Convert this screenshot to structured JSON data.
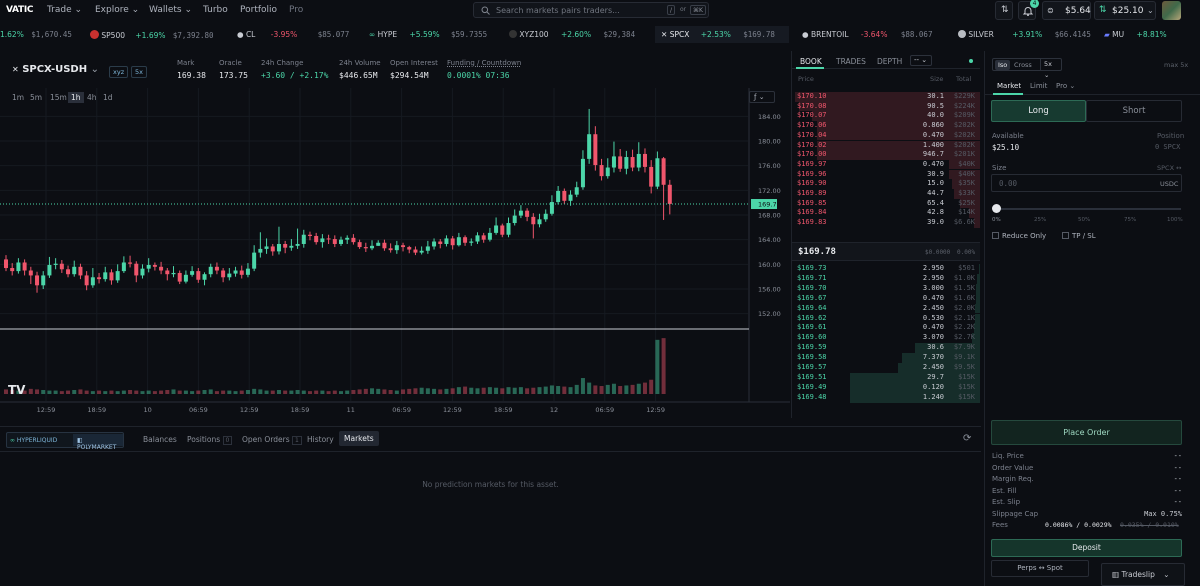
{
  "nav": {
    "logo": "VATIC",
    "items": [
      "Trade",
      "Explore",
      "Wallets",
      "Turbo",
      "Portfolio",
      "Pro"
    ],
    "search_placeholder": "Search markets pairs traders...",
    "kbd_slash": "/",
    "kbd_or": "or",
    "kbd_cmd": "⌘K",
    "notification_count": "4",
    "balance1": "$5.64",
    "balance2": "$25.10"
  },
  "ticker": [
    {
      "chg": "1.62%",
      "price": "$1,670.45",
      "dir": "up",
      "sym": ""
    },
    {
      "sym": "SP500",
      "chg": "+1.69%",
      "price": "$7,392.80",
      "dir": "up"
    },
    {
      "sym": "CL",
      "chg": "-3.95%",
      "price": "$85.077",
      "dir": "dn"
    },
    {
      "sym": "HYPE",
      "chg": "+5.59%",
      "price": "$59.7355",
      "dir": "up"
    },
    {
      "sym": "XYZ100",
      "chg": "+2.60%",
      "price": "$29,384",
      "dir": "up"
    },
    {
      "sym": "SPCX",
      "chg": "+2.53%",
      "price": "$169.78",
      "dir": "up"
    },
    {
      "sym": "BRENTOIL",
      "chg": "-3.64%",
      "price": "$88.067",
      "dir": "dn"
    },
    {
      "sym": "SILVER",
      "chg": "+3.91%",
      "price": "$66.4145",
      "dir": "up"
    },
    {
      "sym": "MU",
      "chg": "+8.81%",
      "price": "",
      "dir": "up"
    }
  ],
  "pair": {
    "symbol": "SPCX-USDH",
    "tag1": "xyz",
    "tag2": "5x",
    "stats": [
      {
        "label": "Mark",
        "value": "169.38",
        "dir": ""
      },
      {
        "label": "Oracle",
        "value": "173.75",
        "dir": ""
      },
      {
        "label": "24h Change",
        "value": "+3.60 / +2.17%",
        "dir": "up"
      },
      {
        "label": "24h Volume",
        "value": "$446.65M",
        "dir": ""
      },
      {
        "label": "Open Interest",
        "value": "$294.54M",
        "dir": ""
      },
      {
        "label": "Funding / Countdown",
        "value": "0.0001% 07:36",
        "dir": "up"
      }
    ]
  },
  "chart": {
    "intervals": [
      "1m",
      "5m",
      "15m",
      "1h",
      "4h",
      "1d"
    ],
    "active_interval": "1h",
    "fx_label": "ƒ",
    "price_ticks": [
      "184.00",
      "180.00",
      "176.00",
      "172.00",
      "168.00",
      "164.00",
      "160.00",
      "156.00",
      "152.00"
    ],
    "last_price_tag": "169.78",
    "time_ticks": [
      "12:59",
      "18:59",
      "10",
      "06:59",
      "12:59",
      "18:59",
      "11",
      "06:59",
      "12:59",
      "18:59",
      "12",
      "06:59",
      "12:59"
    ],
    "watermark": "TV",
    "colors": {
      "up": "#4cd6a9",
      "down": "#f0566c"
    }
  },
  "chart_data": {
    "type": "candlestick",
    "title": "",
    "xlabel": "",
    "ylabel": "",
    "ylim": [
      150,
      186
    ],
    "x_tick_labels": [
      "12:59",
      "18:59",
      "10",
      "06:59",
      "12:59",
      "18:59",
      "11",
      "06:59",
      "12:59",
      "18:59",
      "12",
      "06:59",
      "12:59"
    ],
    "y_tick_labels": [
      "184.00",
      "180.00",
      "176.00",
      "172.00",
      "168.00",
      "164.00",
      "160.00",
      "156.00",
      "152.00"
    ],
    "last_price": 169.78,
    "candles": [
      [
        160.8,
        159.4,
        161.5,
        158.9
      ],
      [
        159.4,
        158.9,
        160.2,
        158.2
      ],
      [
        158.9,
        160.3,
        161.0,
        158.5
      ],
      [
        160.3,
        159.0,
        160.8,
        158.2
      ],
      [
        159.0,
        158.2,
        159.6,
        156.8
      ],
      [
        158.2,
        156.6,
        158.8,
        155.4
      ],
      [
        156.6,
        158.2,
        158.9,
        156.0
      ],
      [
        158.2,
        159.9,
        161.2,
        157.8
      ],
      [
        159.9,
        160.1,
        161.0,
        159.2
      ],
      [
        160.1,
        159.2,
        160.7,
        158.6
      ],
      [
        159.2,
        158.4,
        159.8,
        157.9
      ],
      [
        158.4,
        159.6,
        160.6,
        158.0
      ],
      [
        159.6,
        158.2,
        160.1,
        157.6
      ],
      [
        158.2,
        156.6,
        158.9,
        155.8
      ],
      [
        156.6,
        157.9,
        159.4,
        156.2
      ],
      [
        157.9,
        157.6,
        158.6,
        156.9
      ],
      [
        157.6,
        158.7,
        159.6,
        157.2
      ],
      [
        158.7,
        157.4,
        159.2,
        156.7
      ],
      [
        157.4,
        158.9,
        160.0,
        157.0
      ],
      [
        158.9,
        160.3,
        161.3,
        158.6
      ],
      [
        160.3,
        160.1,
        161.4,
        159.5
      ],
      [
        160.1,
        158.2,
        160.5,
        157.1
      ],
      [
        158.2,
        159.3,
        160.0,
        157.7
      ],
      [
        159.3,
        159.9,
        161.0,
        158.7
      ],
      [
        159.9,
        159.6,
        160.3,
        159.0
      ],
      [
        159.6,
        159.0,
        160.4,
        158.4
      ],
      [
        159.0,
        158.4,
        159.4,
        157.4
      ],
      [
        158.4,
        158.6,
        159.7,
        157.9
      ],
      [
        158.6,
        157.2,
        159.0,
        156.8
      ],
      [
        157.2,
        158.3,
        159.0,
        156.9
      ],
      [
        158.3,
        158.9,
        159.7,
        158.0
      ],
      [
        158.9,
        157.5,
        159.4,
        157.0
      ],
      [
        157.5,
        158.4,
        158.7,
        156.6
      ],
      [
        158.4,
        159.6,
        160.1,
        157.9
      ],
      [
        159.6,
        159.0,
        160.3,
        158.4
      ],
      [
        159.0,
        157.9,
        159.4,
        157.1
      ],
      [
        157.9,
        158.5,
        159.4,
        157.4
      ],
      [
        158.5,
        159.0,
        159.6,
        158.0
      ],
      [
        159.0,
        158.3,
        159.8,
        157.7
      ],
      [
        158.3,
        159.3,
        160.2,
        157.9
      ],
      [
        159.3,
        161.9,
        163.1,
        158.9
      ],
      [
        161.9,
        162.5,
        165.2,
        161.1
      ],
      [
        162.5,
        162.9,
        164.2,
        161.7
      ],
      [
        162.9,
        162.1,
        163.3,
        161.4
      ],
      [
        162.1,
        163.3,
        166.1,
        161.6
      ],
      [
        163.3,
        162.7,
        163.8,
        161.8
      ],
      [
        162.7,
        163.0,
        164.1,
        162.2
      ],
      [
        163.0,
        163.3,
        165.8,
        162.5
      ],
      [
        163.3,
        164.8,
        165.6,
        162.7
      ],
      [
        164.8,
        164.6,
        165.3,
        163.9
      ],
      [
        164.6,
        163.6,
        165.1,
        163.2
      ],
      [
        163.6,
        164.2,
        164.9,
        162.7
      ],
      [
        164.2,
        164.1,
        164.8,
        163.3
      ],
      [
        164.1,
        163.3,
        164.7,
        162.8
      ],
      [
        163.3,
        164.0,
        164.5,
        163.0
      ],
      [
        164.0,
        164.3,
        164.7,
        163.3
      ],
      [
        164.3,
        163.6,
        164.9,
        163.2
      ],
      [
        163.6,
        162.8,
        164.0,
        162.5
      ],
      [
        162.8,
        162.6,
        163.5,
        162.0
      ],
      [
        162.6,
        163.0,
        163.9,
        162.3
      ],
      [
        163.0,
        163.5,
        163.9,
        163.0
      ],
      [
        163.5,
        162.6,
        164.0,
        162.2
      ],
      [
        162.6,
        162.3,
        163.4,
        161.9
      ],
      [
        162.3,
        163.1,
        163.8,
        161.7
      ],
      [
        163.1,
        162.8,
        163.5,
        162.1
      ],
      [
        162.8,
        162.4,
        163.0,
        161.8
      ],
      [
        162.4,
        161.9,
        162.9,
        161.5
      ],
      [
        161.9,
        162.2,
        162.9,
        161.6
      ],
      [
        162.2,
        162.9,
        163.8,
        161.7
      ],
      [
        162.9,
        163.7,
        164.2,
        162.4
      ],
      [
        163.7,
        163.3,
        164.1,
        162.6
      ],
      [
        163.3,
        164.2,
        164.7,
        162.9
      ],
      [
        164.2,
        163.1,
        164.6,
        162.4
      ],
      [
        163.1,
        164.4,
        165.1,
        162.9
      ],
      [
        164.4,
        163.5,
        164.7,
        163.0
      ],
      [
        163.5,
        163.7,
        164.2,
        163.0
      ],
      [
        163.7,
        164.7,
        165.2,
        163.3
      ],
      [
        164.7,
        164.0,
        165.1,
        163.5
      ],
      [
        164.0,
        165.1,
        165.9,
        163.7
      ],
      [
        165.1,
        166.3,
        167.6,
        164.8
      ],
      [
        166.3,
        164.8,
        166.6,
        164.4
      ],
      [
        164.8,
        166.7,
        167.6,
        164.4
      ],
      [
        166.7,
        167.9,
        168.9,
        166.3
      ],
      [
        167.9,
        168.7,
        169.6,
        167.5
      ],
      [
        168.7,
        167.7,
        169.1,
        167.0
      ],
      [
        167.7,
        166.5,
        168.3,
        164.2
      ],
      [
        166.5,
        167.3,
        168.2,
        166.0
      ],
      [
        167.3,
        168.2,
        168.9,
        166.9
      ],
      [
        168.2,
        170.1,
        171.2,
        167.9
      ],
      [
        170.1,
        171.9,
        172.7,
        169.7
      ],
      [
        171.9,
        170.3,
        172.3,
        169.8
      ],
      [
        170.3,
        171.3,
        172.0,
        169.5
      ],
      [
        171.3,
        172.5,
        173.4,
        170.9
      ],
      [
        172.5,
        177.1,
        178.5,
        172.1
      ],
      [
        177.1,
        181.1,
        185.2,
        176.3
      ],
      [
        181.1,
        176.1,
        182.4,
        175.2
      ],
      [
        176.1,
        174.3,
        177.1,
        173.6
      ],
      [
        174.3,
        175.7,
        177.2,
        173.9
      ],
      [
        175.7,
        177.5,
        179.9,
        174.9
      ],
      [
        177.5,
        175.5,
        178.7,
        175.0
      ],
      [
        175.5,
        177.4,
        178.4,
        174.6
      ],
      [
        177.4,
        175.7,
        178.6,
        175.1
      ],
      [
        175.7,
        177.9,
        179.8,
        175.1
      ],
      [
        177.9,
        175.8,
        178.8,
        174.9
      ],
      [
        175.8,
        172.6,
        176.9,
        171.5
      ],
      [
        172.6,
        177.2,
        178.3,
        172.2
      ],
      [
        177.2,
        172.9,
        177.4,
        167.2
      ],
      [
        172.9,
        169.8,
        173.7,
        168.1
      ]
    ],
    "volume": [
      8,
      7,
      6,
      6,
      9,
      8,
      7,
      6,
      6,
      5,
      6,
      7,
      8,
      6,
      5,
      6,
      5,
      6,
      5,
      6,
      7,
      6,
      5,
      6,
      5,
      6,
      7,
      8,
      6,
      6,
      5,
      6,
      7,
      8,
      5,
      6,
      6,
      5,
      6,
      7,
      9,
      8,
      6,
      6,
      7,
      6,
      6,
      7,
      6,
      5,
      6,
      6,
      5,
      6,
      5,
      6,
      7,
      8,
      9,
      10,
      9,
      8,
      7,
      6,
      8,
      9,
      10,
      11,
      10,
      9,
      8,
      9,
      10,
      12,
      13,
      11,
      10,
      11,
      12,
      11,
      10,
      12,
      11,
      12,
      10,
      11,
      12,
      13,
      15,
      14,
      13,
      12,
      16,
      28,
      20,
      15,
      14,
      16,
      18,
      14,
      15,
      16,
      18,
      20,
      25,
      95,
      98
    ]
  },
  "book": {
    "tabs": [
      "BOOK",
      "TRADES",
      "DEPTH"
    ],
    "agg": "--",
    "headers": [
      "Price",
      "Size",
      "Total"
    ],
    "asks": [
      {
        "p": "$170.10",
        "s": "30.1",
        "t": "$229K",
        "d": 100
      },
      {
        "p": "$170.08",
        "s": "90.5",
        "t": "$224K",
        "d": 98
      },
      {
        "p": "$170.07",
        "s": "40.0",
        "t": "$209K",
        "d": 91
      },
      {
        "p": "$170.06",
        "s": "0.860",
        "t": "$202K",
        "d": 88
      },
      {
        "p": "$170.04",
        "s": "0.470",
        "t": "$202K",
        "d": 88
      },
      {
        "p": "$170.02",
        "s": "1.400",
        "t": "$202K",
        "d": 88
      },
      {
        "p": "$170.00",
        "s": "946.7",
        "t": "$201K",
        "d": 88
      },
      {
        "p": "$169.97",
        "s": "0.470",
        "t": "$40K",
        "d": 17
      },
      {
        "p": "$169.96",
        "s": "30.9",
        "t": "$40K",
        "d": 17
      },
      {
        "p": "$169.90",
        "s": "15.0",
        "t": "$35K",
        "d": 15
      },
      {
        "p": "$169.89",
        "s": "44.7",
        "t": "$33K",
        "d": 14
      },
      {
        "p": "$169.85",
        "s": "65.4",
        "t": "$25K",
        "d": 11
      },
      {
        "p": "$169.84",
        "s": "42.8",
        "t": "$14K",
        "d": 6
      },
      {
        "p": "$169.83",
        "s": "39.0",
        "t": "$6.6K",
        "d": 3
      }
    ],
    "mid_price": "$169.78",
    "spread": "$0.0000",
    "spread_pct": "0.00%",
    "bids": [
      {
        "p": "$169.73",
        "s": "2.950",
        "t": "$501",
        "d": 1
      },
      {
        "p": "$169.71",
        "s": "2.950",
        "t": "$1.0K",
        "d": 2
      },
      {
        "p": "$169.70",
        "s": "3.000",
        "t": "$1.5K",
        "d": 3
      },
      {
        "p": "$169.67",
        "s": "0.470",
        "t": "$1.6K",
        "d": 3
      },
      {
        "p": "$169.64",
        "s": "2.450",
        "t": "$2.0K",
        "d": 4
      },
      {
        "p": "$169.62",
        "s": "0.530",
        "t": "$2.1K",
        "d": 4
      },
      {
        "p": "$169.61",
        "s": "0.470",
        "t": "$2.2K",
        "d": 5
      },
      {
        "p": "$169.60",
        "s": "3.070",
        "t": "$2.7K",
        "d": 6
      },
      {
        "p": "$169.59",
        "s": "30.6",
        "t": "$7.9K",
        "d": 50
      },
      {
        "p": "$169.58",
        "s": "7.370",
        "t": "$9.1K",
        "d": 60
      },
      {
        "p": "$169.57",
        "s": "2.450",
        "t": "$9.5K",
        "d": 63
      },
      {
        "p": "$169.51",
        "s": "29.7",
        "t": "$15K",
        "d": 100
      },
      {
        "p": "$169.49",
        "s": "0.120",
        "t": "$15K",
        "d": 100
      },
      {
        "p": "$169.48",
        "s": "1.240",
        "t": "$15K",
        "d": 100
      }
    ]
  },
  "trade": {
    "margin_modes": [
      "Iso",
      "Cross"
    ],
    "leverage": "5x",
    "max_label": "max 5x",
    "order_types": [
      "Market",
      "Limit",
      "Pro"
    ],
    "long": "Long",
    "short": "Short",
    "available_label": "Available",
    "available_value": "$25.10",
    "position_label": "Position",
    "position_value": "0 SPCX",
    "size_label": "Size",
    "size_unit_toggle": "SPCX ↔",
    "size_placeholder": "0.00",
    "size_currency": "USDC",
    "slider_value": 0,
    "slider_labels": [
      "0%",
      "25%",
      "50%",
      "75%",
      "100%"
    ],
    "reduce_only": "Reduce Only",
    "tp_sl": "TP / SL",
    "place_order": "Place Order",
    "details": [
      {
        "k": "Liq. Price",
        "v": "--"
      },
      {
        "k": "Order Value",
        "v": "--"
      },
      {
        "k": "Margin Req.",
        "v": "--"
      },
      {
        "k": "Est. Fill",
        "v": "--"
      },
      {
        "k": "Est. Slip",
        "v": "--"
      },
      {
        "k": "Slippage Cap",
        "v": "Max 0.75%"
      }
    ],
    "fees_label": "Fees",
    "fees_value": "0.0086% / 0.0029%",
    "fees_strike": "0.035% / 0.010%",
    "deposit": "Deposit",
    "perps_spot": "Perps ↔ Spot",
    "tradeslip": "Tradeslip"
  },
  "bottom": {
    "venue1": "HYPERLIQUID",
    "venue2": "POLYMARKET",
    "tabs": [
      {
        "label": "Balances",
        "count": ""
      },
      {
        "label": "Positions",
        "count": "0"
      },
      {
        "label": "Open Orders",
        "count": "1"
      },
      {
        "label": "History",
        "count": ""
      },
      {
        "label": "Markets",
        "count": ""
      }
    ],
    "active_tab": "Markets",
    "empty_message": "No prediction markets for this asset."
  }
}
